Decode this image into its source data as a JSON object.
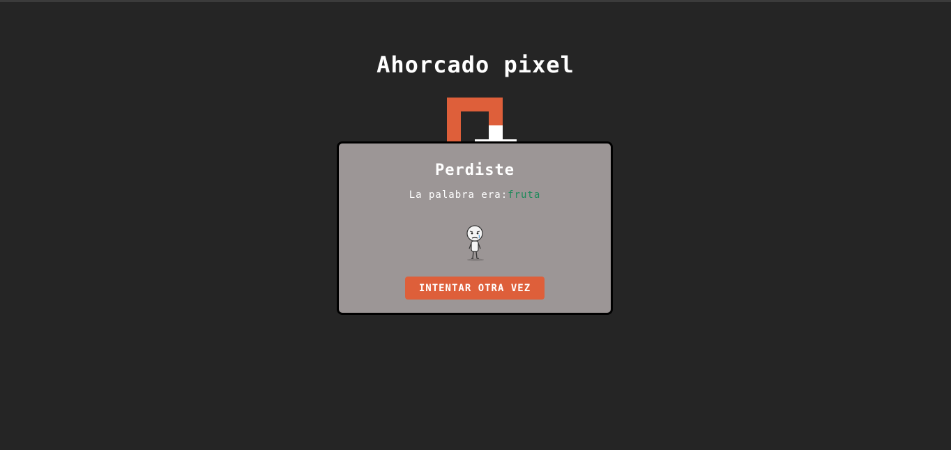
{
  "app": {
    "title": "Ahorcado pixel"
  },
  "modal": {
    "title": "Perdiste",
    "message_prefix": "La palabra era:",
    "word": "fruta",
    "image_icon": "sad-stick-figure-icon",
    "retry_label": "INTENTAR OTRA VEZ"
  },
  "colors": {
    "background": "#252525",
    "accent": "#de5f3a",
    "modal_bg": "#9c9696",
    "word_color": "#1f8a5b"
  }
}
